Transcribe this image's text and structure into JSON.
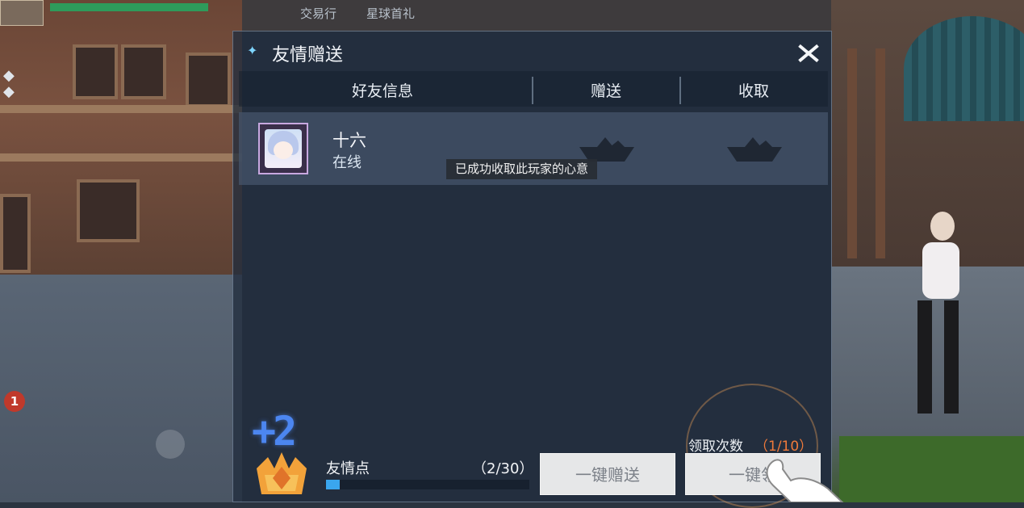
{
  "hud": {
    "top_tabs": [
      "交易行",
      "星球首礼"
    ],
    "notification_count": "1",
    "hp_fraction": 1.0
  },
  "dialog": {
    "title": "友情赠送",
    "columns": [
      "好友信息",
      "赠送",
      "收取"
    ],
    "friends": [
      {
        "name": "十六",
        "status": "在线"
      }
    ],
    "toast": "已成功收取此玩家的心意",
    "popup_gain": "+2",
    "points": {
      "label": "友情点",
      "count": "（2/30）",
      "fraction": 0.0667
    },
    "claim": {
      "label": "领取次数",
      "count": "（1/10）"
    },
    "buttons": {
      "send_all": "一键赠送",
      "claim_all": "一键领"
    }
  },
  "colors": {
    "accent_blue": "#3aa6ee",
    "claim_count": "#f07a3a",
    "button_bg": "#e6e7e8"
  }
}
